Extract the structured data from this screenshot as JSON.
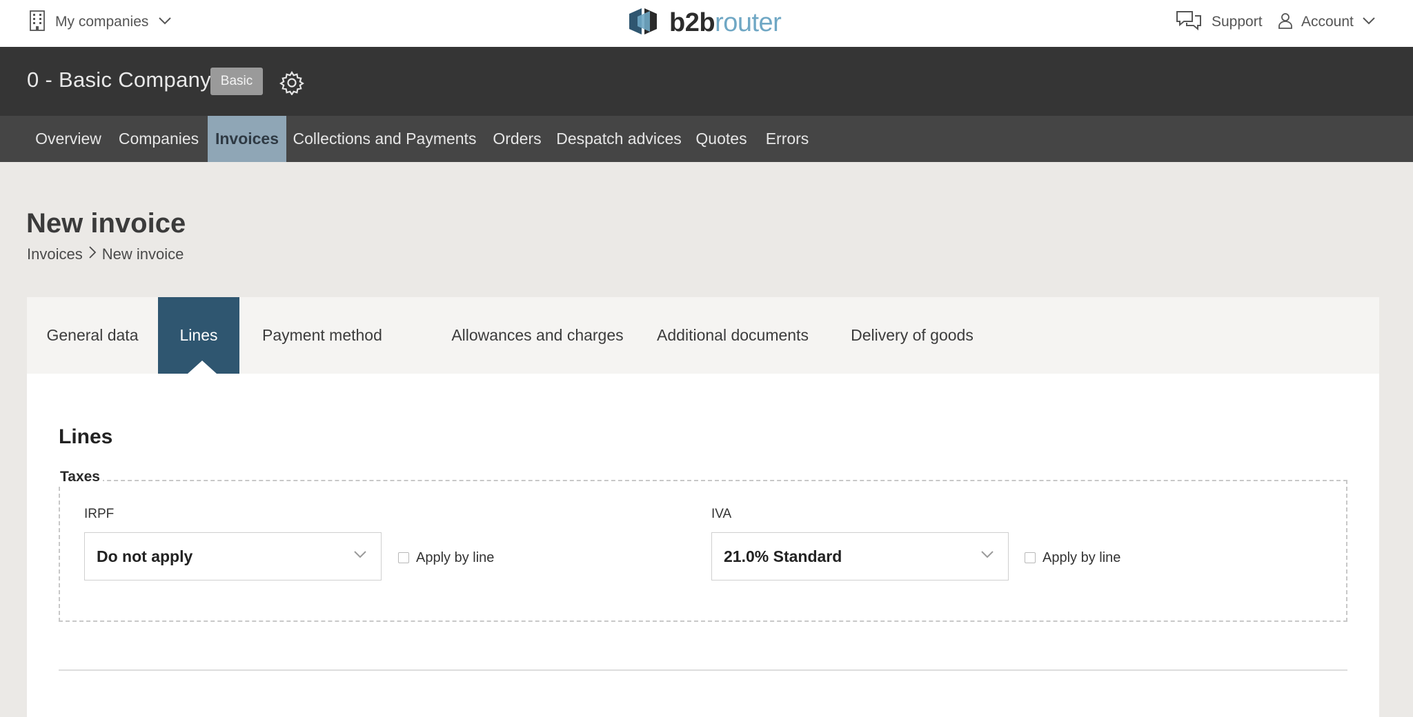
{
  "topbar": {
    "companies_label": "My companies",
    "logo_text_a": "b2b",
    "logo_text_b": "router",
    "support_label": "Support",
    "account_label": "Account"
  },
  "company": {
    "name": "0 - Basic Company",
    "plan_badge": "Basic"
  },
  "nav": {
    "items": [
      "Overview",
      "Companies",
      "Invoices",
      "Collections and Payments",
      "Orders",
      "Despatch advices",
      "Quotes",
      "Errors"
    ],
    "active": "Invoices"
  },
  "page": {
    "title": "New invoice",
    "breadcrumb": [
      "Invoices",
      "New invoice"
    ]
  },
  "tabs": {
    "items": [
      "General data",
      "Lines",
      "Payment method",
      "Allowances and charges",
      "Additional documents",
      "Delivery of goods"
    ],
    "active": "Lines"
  },
  "lines": {
    "section_title": "Lines",
    "taxes_legend": "Taxes",
    "irpf": {
      "label": "IRPF",
      "value": "Do not apply",
      "apply_by_line_label": "Apply by line",
      "apply_by_line_checked": false
    },
    "iva": {
      "label": "IVA",
      "value": "21.0% Standard",
      "apply_by_line_label": "Apply by line",
      "apply_by_line_checked": false
    }
  },
  "colors": {
    "topbar_bg": "#ffffff",
    "company_bar_bg": "#353535",
    "nav_bg": "#454545",
    "nav_active_bg": "#8fa6b6",
    "tab_active_bg": "#2f5670",
    "page_bg": "#ebe9e6",
    "logo_accent": "#6fa7c4"
  },
  "icons": {
    "companies": "building-icon",
    "dropdown": "chevron-down-icon",
    "support": "chat-bubbles-icon",
    "account": "user-icon",
    "settings": "gear-icon",
    "breadcrumb_separator": "chevron-right-icon"
  }
}
